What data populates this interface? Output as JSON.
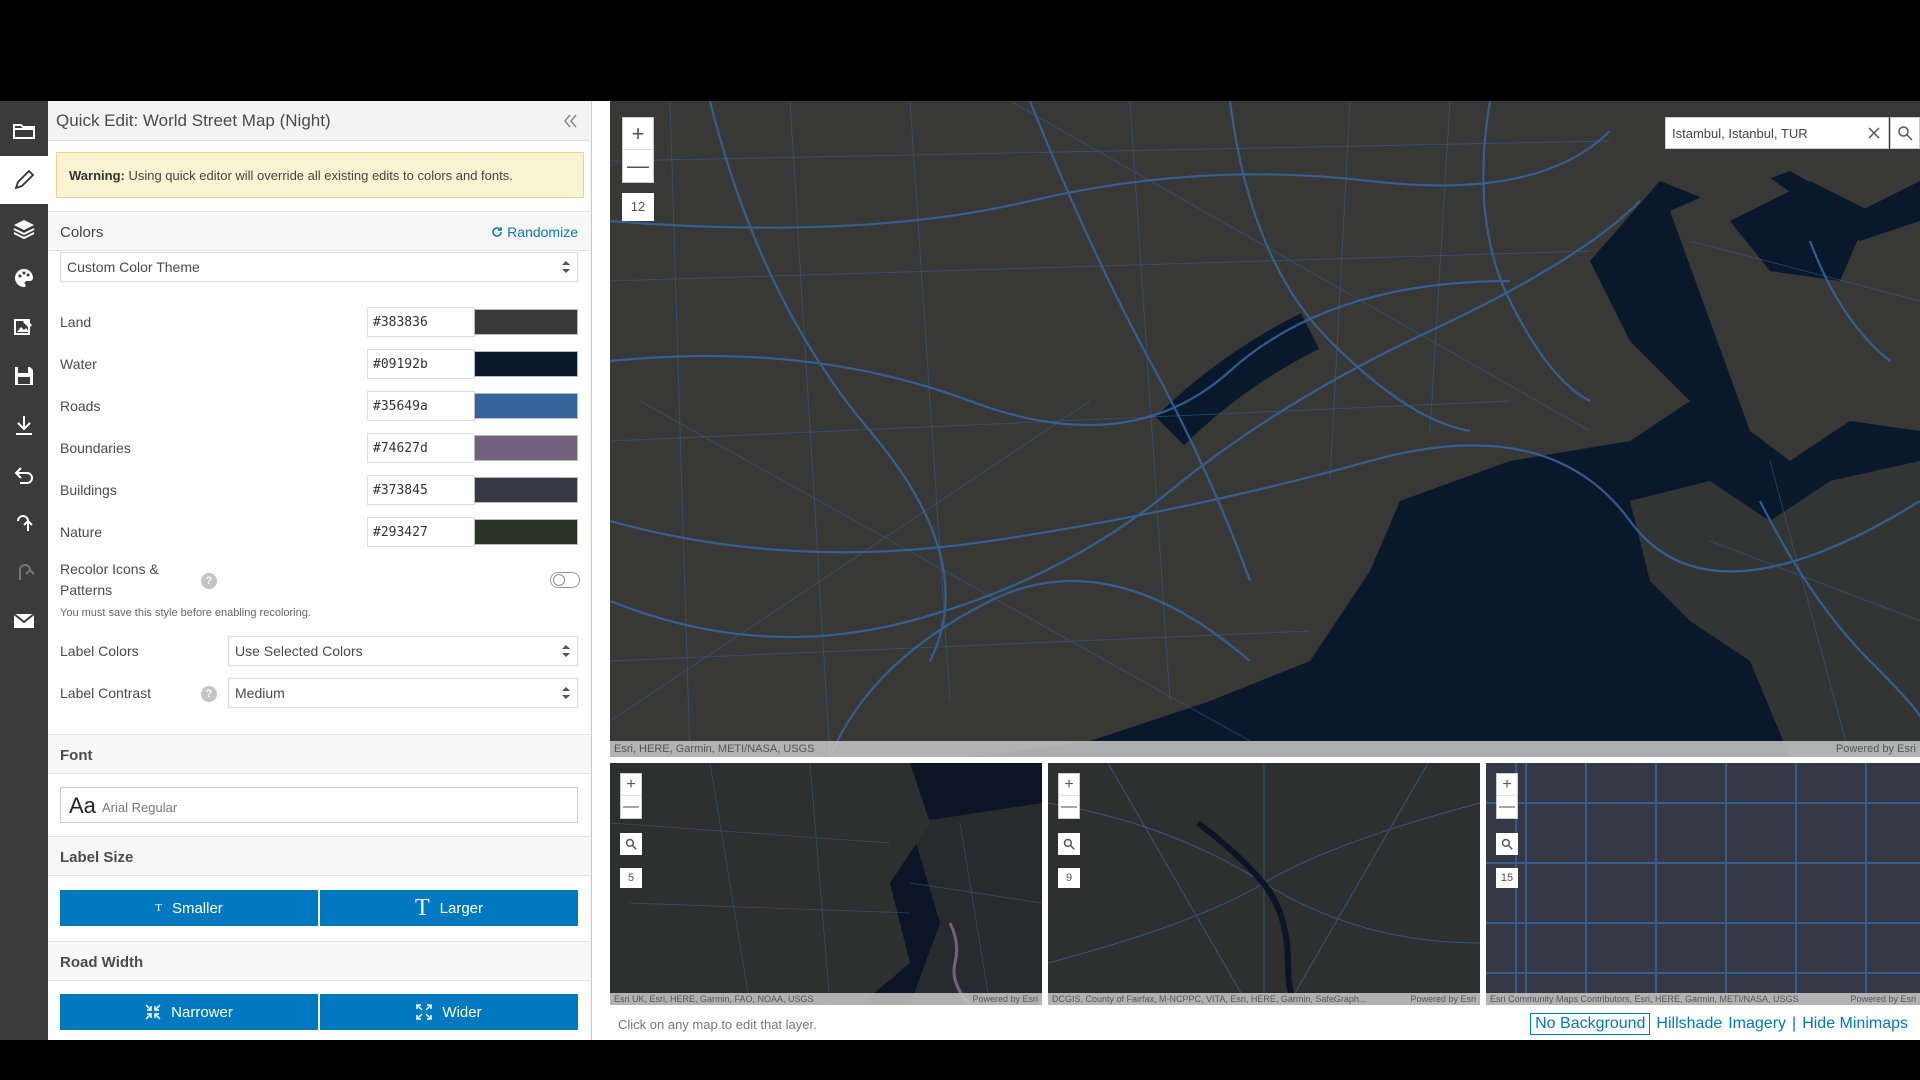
{
  "panel": {
    "title": "Quick Edit: World Street Map (Night)",
    "warning_bold": "Warning:",
    "warning_text": " Using quick editor will override all existing edits to colors and fonts."
  },
  "colors": {
    "heading": "Colors",
    "randomize": "Randomize",
    "theme": "Custom Color Theme",
    "rows": [
      {
        "name": "Land",
        "hex": "#383836"
      },
      {
        "name": "Water",
        "hex": "#09192b"
      },
      {
        "name": "Roads",
        "hex": "#35649a"
      },
      {
        "name": "Boundaries",
        "hex": "#74627d"
      },
      {
        "name": "Buildings",
        "hex": "#373845"
      },
      {
        "name": "Nature",
        "hex": "#293427"
      }
    ],
    "recolor_line1": "Recolor Icons &",
    "recolor_line2": "Patterns",
    "recolor_note": "You must save this style before enabling recoloring.",
    "label_colors_label": "Label Colors",
    "label_colors_value": "Use Selected Colors",
    "label_contrast_label": "Label Contrast",
    "label_contrast_value": "Medium"
  },
  "font": {
    "heading": "Font",
    "sample": "Aa",
    "name": "Arial Regular"
  },
  "label_size": {
    "heading": "Label Size",
    "smaller": "Smaller",
    "larger": "Larger",
    "smaller_glyph": "T",
    "larger_glyph": "T"
  },
  "road_width": {
    "heading": "Road Width",
    "narrower": "Narrower",
    "wider": "Wider"
  },
  "main_map": {
    "zoom_in": "+",
    "zoom_out": "—",
    "zoom_level": "12",
    "search_value": "Istambul, Istanbul, TUR",
    "attribution": "Esri, HERE, Garmin, METI/NASA, USGS",
    "powered": "Powered by Esri"
  },
  "minimaps": [
    {
      "zoom_level": "5",
      "attribution": "Esri UK, Esri, HERE, Garmin, FAO, NOAA, USGS",
      "powered": "Powered by Esri"
    },
    {
      "zoom_level": "9",
      "attribution": "DCGIS, County of Fairfax, M-NCPPC, VITA, Esri, HERE, Garmin, SafeGraph...",
      "powered": "Powered by Esri"
    },
    {
      "zoom_level": "15",
      "attribution": "Esri Community Maps Contributors, Esri, HERE, Garmin, METI/NASA, USGS",
      "powered": "Powered by Esri"
    }
  ],
  "footer": {
    "hint": "Click on any map to edit that layer.",
    "no_background": "No Background",
    "hillshade": "Hillshade",
    "imagery": "Imagery",
    "sep": "|",
    "hide_minimaps": "Hide Minimaps"
  },
  "icons": [
    "folder-icon",
    "pencil-icon",
    "layers-icon",
    "palette-icon",
    "image-edit-icon",
    "save-icon",
    "download-icon",
    "share-back-icon",
    "undo-icon",
    "redo-icon",
    "mail-icon"
  ],
  "theme_colors": {
    "accent": "#0079c1",
    "toolbar": "#3b3b3b",
    "water": "#09192b",
    "land": "#383836",
    "roads": "#35649a"
  }
}
